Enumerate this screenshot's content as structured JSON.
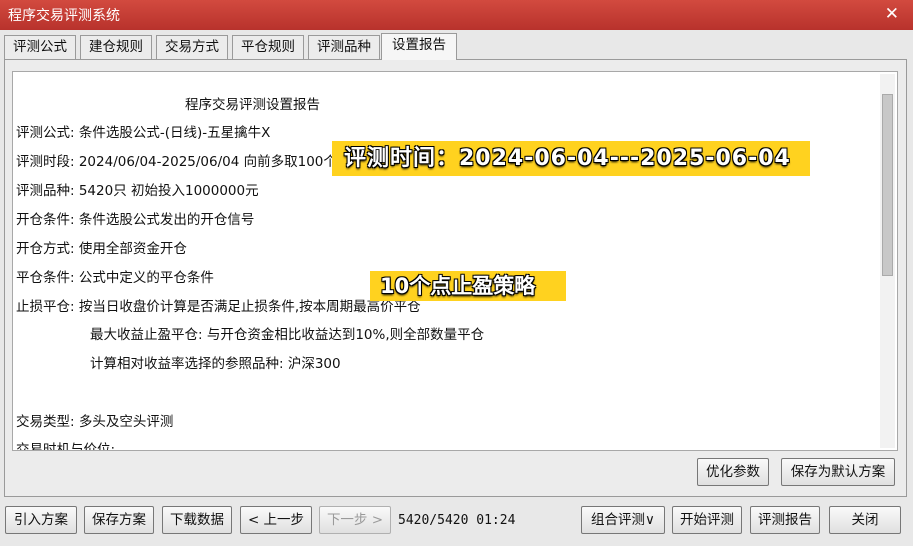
{
  "window": {
    "title": "程序交易评测系统",
    "close_glyph": "✕"
  },
  "tabs": [
    {
      "label": "评测公式"
    },
    {
      "label": "建仓规则"
    },
    {
      "label": "交易方式"
    },
    {
      "label": "平仓规则"
    },
    {
      "label": "评测品种"
    },
    {
      "label": "设置报告"
    }
  ],
  "report": {
    "title": "程序交易评测设置报告",
    "lines": [
      "评测公式:  条件选股公式-(日线)-五星擒牛X",
      "评测时段:  2024/06/04-2025/06/04 向前多取100个数据用于计算 强制平仓计入收益",
      "评测品种:  5420只 初始投入1000000元",
      "开仓条件:  条件选股公式发出的开仓信号",
      "开仓方式:  使用全部资金开仓",
      "平仓条件:  公式中定义的平仓条件",
      "止损平仓:  按当日收盘价计算是否满足止损条件,按本周期最高价平仓",
      "最大收益止盈平仓:  与开仓资金相比收益达到10%,则全部数量平仓",
      "计算相对收益率选择的参照品种:  沪深300",
      "交易类型:  多头及空头评测",
      "交易时机与价位:"
    ]
  },
  "overlays": {
    "eval_time": "评测时间：2024-06-04---2025-06-04",
    "strategy": "10个点止盈策略"
  },
  "panel_buttons": {
    "optimize": "优化参数",
    "save_default": "保存为默认方案"
  },
  "bottom_bar": {
    "import": "引入方案",
    "save": "保存方案",
    "download": "下载数据",
    "prev": "< 上一步",
    "next": "下一步 >",
    "status": "5420/5420 01:24",
    "combo": "组合评测∨",
    "start": "开始评测",
    "report": "评测报告",
    "close": "关闭"
  },
  "colors": {
    "titlebar": "#c43d35",
    "highlight": "#ffd21f"
  }
}
